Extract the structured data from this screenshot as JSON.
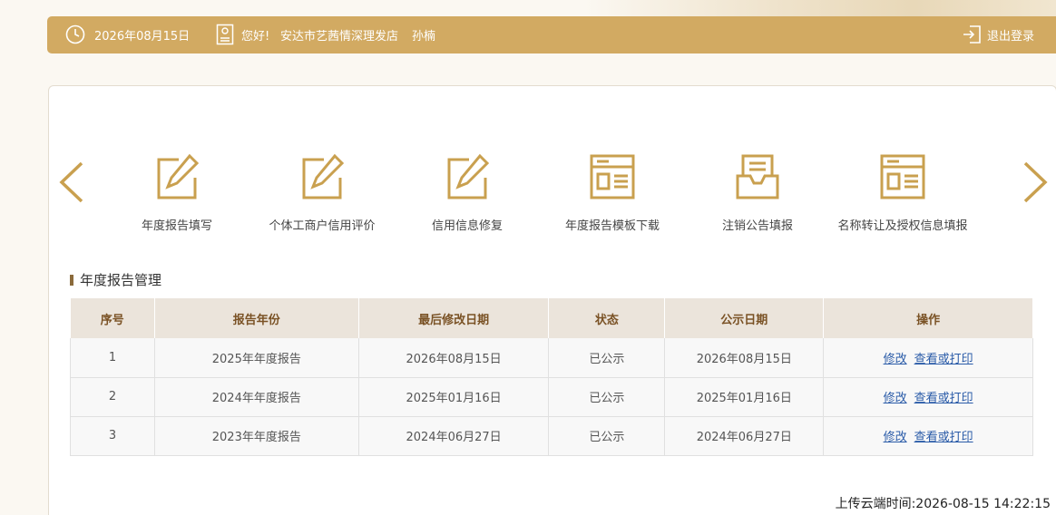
{
  "header": {
    "date": "2026年08月15日",
    "greeting": "您好!",
    "shop_name": "安达市艺茜情深理发店",
    "user_name": "孙楠",
    "logout_label": "退出登录"
  },
  "services": [
    {
      "label": "年度报告填写",
      "icon": "edit-icon"
    },
    {
      "label": "个体工商户信用评价",
      "icon": "edit-icon"
    },
    {
      "label": "信用信息修复",
      "icon": "edit-icon"
    },
    {
      "label": "年度报告模板下载",
      "icon": "template-icon"
    },
    {
      "label": "注销公告填报",
      "icon": "inbox-icon"
    },
    {
      "label": "名称转让及授权信息填报",
      "icon": "template-icon"
    }
  ],
  "section": {
    "title": "年度报告管理"
  },
  "table": {
    "headers": [
      "序号",
      "报告年份",
      "最后修改日期",
      "状态",
      "公示日期",
      "操作"
    ],
    "rows": [
      {
        "index": "1",
        "year": "2025年年度报告",
        "modified": "2026年08月15日",
        "status": "已公示",
        "published": "2026年08月15日",
        "edit": "修改",
        "view": "查看或打印"
      },
      {
        "index": "2",
        "year": "2024年年度报告",
        "modified": "2025年01月16日",
        "status": "已公示",
        "published": "2025年01月16日",
        "edit": "修改",
        "view": "查看或打印"
      },
      {
        "index": "3",
        "year": "2023年年度报告",
        "modified": "2024年06月27日",
        "status": "已公示",
        "published": "2024年06月27日",
        "edit": "修改",
        "view": "查看或打印"
      }
    ]
  },
  "footer": {
    "upload_time": "上传云端时间:2026-08-15 14:22:15"
  },
  "colors": {
    "accent": "#d2aa62",
    "icon": "#c9a04f",
    "header_text": "#7a5225",
    "link": "#2a5ba8"
  }
}
